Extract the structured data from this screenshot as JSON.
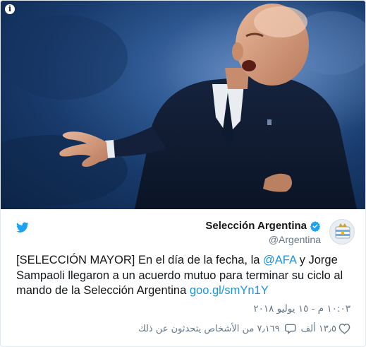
{
  "tweet": {
    "author": {
      "name": "Selección Argentina",
      "handle": "@Argentina",
      "verified": true
    },
    "text": {
      "part1": "[SELECCIÓN MAYOR] En el día de la fecha, la ",
      "mention": "@AFA",
      "part2": " y Jorge Sampaoli llegaron a un acuerdo mutuo para terminar su ciclo al mando de la Selección Argentina ",
      "link": "goo.gl/smYn1Y"
    },
    "timestamp": "١٠:٠٣ م - ١٥ يوليو ٢٠١٨",
    "likes": "١٣٫٥ ألف",
    "replies": "٧٫١٦٩ من الأشخاص يتحدثون عن ذلك"
  },
  "media": {
    "info_label": "i"
  },
  "colors": {
    "link": "#1b95e0",
    "twitter_blue": "#1da1f2",
    "meta": "#657786",
    "text": "#14171a"
  },
  "icons": {
    "source": "twitter-bird-icon",
    "verified": "verified-badge-icon",
    "like": "heart-icon",
    "reply": "comment-bubble-icon",
    "info": "info-icon"
  }
}
